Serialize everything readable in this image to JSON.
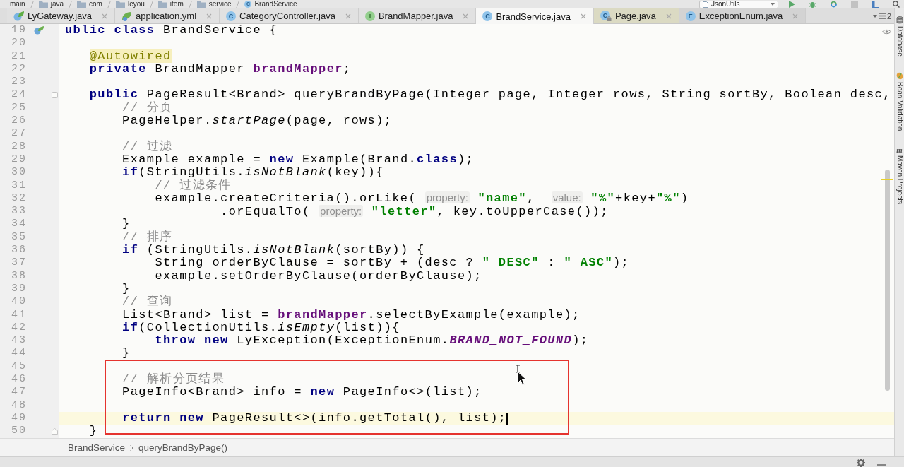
{
  "navigation_bar": {
    "breadcrumb": [
      {
        "label": "main",
        "kind": "plain"
      },
      {
        "label": "java",
        "kind": "folder"
      },
      {
        "label": "com",
        "kind": "folder"
      },
      {
        "label": "leyou",
        "kind": "folder"
      },
      {
        "label": "item",
        "kind": "folder"
      },
      {
        "label": "service",
        "kind": "folder"
      },
      {
        "label": "BrandService",
        "kind": "class",
        "badge": "C"
      }
    ],
    "run_configuration": "JsonUtils"
  },
  "tabs": [
    {
      "label": "LyGateway.java",
      "kind": "spring",
      "selected": false,
      "color": "#e1e1e1"
    },
    {
      "label": "application.yml",
      "kind": "yaml",
      "selected": false,
      "color": "#e1e1e1"
    },
    {
      "label": "CategoryController.java",
      "kind": "class",
      "badge": "C",
      "selected": false,
      "color": "#e1e1e1"
    },
    {
      "label": "BrandMapper.java",
      "kind": "interface",
      "badge": "I",
      "selected": false,
      "color": "#e1e1e1"
    },
    {
      "label": "BrandService.java",
      "kind": "class",
      "badge": "C",
      "selected": true,
      "color": "#f7f7f6"
    },
    {
      "label": "Page.java",
      "kind": "locked-class",
      "badge": "C",
      "selected": false,
      "color": "#dbdac3"
    },
    {
      "label": "ExceptionEnum.java",
      "kind": "enum",
      "badge": "E",
      "selected": false,
      "color": "#d3d3d3"
    }
  ],
  "hidden_tabs": {
    "count": "2"
  },
  "editor": {
    "lines": [
      {
        "number": "19",
        "current": false,
        "marker": {
          "kind": "bean"
        },
        "tokens": [
          {
            "kind": "keyword",
            "text": "ublic"
          },
          {
            "kind": "keyword",
            "text": " class"
          },
          {
            "kind": "plain",
            "text": " BrandService {"
          }
        ]
      },
      {
        "number": "20",
        "current": false
      },
      {
        "number": "21",
        "current": false,
        "tokens": [
          {
            "kind": "annotation",
            "text": "   @Autowired"
          }
        ]
      },
      {
        "number": "22",
        "current": false,
        "tokens": [
          {
            "kind": "keyword",
            "text": "   private"
          },
          {
            "kind": "plain",
            "text": " BrandMapper "
          },
          {
            "kind": "field",
            "text": "brandMapper"
          },
          {
            "kind": "plain",
            "text": ";"
          }
        ]
      },
      {
        "number": "23",
        "current": false
      },
      {
        "number": "24",
        "current": false,
        "marker": {
          "kind": "fold-start"
        },
        "tokens": [
          {
            "kind": "keyword",
            "text": "   public"
          },
          {
            "kind": "plain",
            "text": " PageResult<Brand> queryBrandByPage(Integer page, Integer rows, String sortBy, Boolean desc,"
          }
        ]
      },
      {
        "number": "25",
        "current": false,
        "tokens": [
          {
            "kind": "comment",
            "text": "       // 分页"
          }
        ]
      },
      {
        "number": "26",
        "current": false,
        "tokens": [
          {
            "kind": "plain",
            "text": "       PageHelper."
          },
          {
            "kind": "static",
            "text": "startPage"
          },
          {
            "kind": "plain",
            "text": "(page, rows);"
          }
        ]
      },
      {
        "number": "27",
        "current": false
      },
      {
        "number": "28",
        "current": false,
        "tokens": [
          {
            "kind": "comment",
            "text": "       // 过滤"
          }
        ]
      },
      {
        "number": "29",
        "current": false,
        "tokens": [
          {
            "kind": "plain",
            "text": "       Example example = "
          },
          {
            "kind": "keyword",
            "text": "new"
          },
          {
            "kind": "plain",
            "text": " Example(Brand."
          },
          {
            "kind": "keyword",
            "text": "class"
          },
          {
            "kind": "plain",
            "text": ");"
          }
        ]
      },
      {
        "number": "30",
        "current": false,
        "tokens": [
          {
            "kind": "keyword",
            "text": "       if"
          },
          {
            "kind": "plain",
            "text": "(StringUtils."
          },
          {
            "kind": "static",
            "text": "isNotBlank"
          },
          {
            "kind": "plain",
            "text": "(key)){"
          }
        ]
      },
      {
        "number": "31",
        "current": false,
        "tokens": [
          {
            "kind": "comment",
            "text": "           // 过滤条件"
          }
        ]
      },
      {
        "number": "32",
        "current": false,
        "tokens": [
          {
            "kind": "plain",
            "text": "           example.createCriteria().orLike("
          },
          {
            "kind": "hint",
            "text": " property:"
          },
          {
            "kind": "string",
            "text": " \"name\""
          },
          {
            "kind": "plain",
            "text": ","
          },
          {
            "kind": "hint",
            "text": "  value:"
          },
          {
            "kind": "string",
            "text": " \"%\""
          },
          {
            "kind": "plain",
            "text": "+key+"
          },
          {
            "kind": "string",
            "text": "\"%\""
          },
          {
            "kind": "plain",
            "text": ")"
          }
        ]
      },
      {
        "number": "33",
        "current": false,
        "tokens": [
          {
            "kind": "plain",
            "text": "                   .orEqualTo("
          },
          {
            "kind": "hint",
            "text": " property:"
          },
          {
            "kind": "string",
            "text": " \"letter\""
          },
          {
            "kind": "plain",
            "text": ", key.toUpperCase());"
          }
        ]
      },
      {
        "number": "34",
        "current": false,
        "tokens": [
          {
            "kind": "plain",
            "text": "       }"
          }
        ]
      },
      {
        "number": "35",
        "current": false,
        "tokens": [
          {
            "kind": "comment",
            "text": "       // 排序"
          }
        ]
      },
      {
        "number": "36",
        "current": false,
        "tokens": [
          {
            "kind": "keyword",
            "text": "       if"
          },
          {
            "kind": "plain",
            "text": " (StringUtils."
          },
          {
            "kind": "static",
            "text": "isNotBlank"
          },
          {
            "kind": "plain",
            "text": "(sortBy)) {"
          }
        ]
      },
      {
        "number": "37",
        "current": false,
        "tokens": [
          {
            "kind": "plain",
            "text": "           String orderByClause = sortBy + (desc ? "
          },
          {
            "kind": "string",
            "text": "\" DESC\""
          },
          {
            "kind": "plain",
            "text": " : "
          },
          {
            "kind": "string",
            "text": "\" ASC\""
          },
          {
            "kind": "plain",
            "text": ");"
          }
        ]
      },
      {
        "number": "38",
        "current": false,
        "tokens": [
          {
            "kind": "plain",
            "text": "           example.setOrderByClause(orderByClause);"
          }
        ]
      },
      {
        "number": "39",
        "current": false,
        "tokens": [
          {
            "kind": "plain",
            "text": "       }"
          }
        ]
      },
      {
        "number": "40",
        "current": false,
        "tokens": [
          {
            "kind": "comment",
            "text": "       // 查询"
          }
        ]
      },
      {
        "number": "41",
        "current": false,
        "tokens": [
          {
            "kind": "plain",
            "text": "       List<Brand> list = "
          },
          {
            "kind": "field",
            "text": "brandMapper"
          },
          {
            "kind": "plain",
            "text": ".selectByExample(example);"
          }
        ]
      },
      {
        "number": "42",
        "current": false,
        "tokens": [
          {
            "kind": "keyword",
            "text": "       if"
          },
          {
            "kind": "plain",
            "text": "(CollectionUtils."
          },
          {
            "kind": "static",
            "text": "isEmpty"
          },
          {
            "kind": "plain",
            "text": "(list)){"
          }
        ]
      },
      {
        "number": "43",
        "current": false,
        "tokens": [
          {
            "kind": "keyword",
            "text": "           throw"
          },
          {
            "kind": "keyword",
            "text": " new"
          },
          {
            "kind": "plain",
            "text": " LyException(ExceptionEnum."
          },
          {
            "kind": "constant",
            "text": "BRAND_NOT_FOUND"
          },
          {
            "kind": "plain",
            "text": ");"
          }
        ]
      },
      {
        "number": "44",
        "current": false,
        "tokens": [
          {
            "kind": "plain",
            "text": "       }"
          }
        ]
      },
      {
        "number": "45",
        "current": false
      },
      {
        "number": "46",
        "current": false,
        "tokens": [
          {
            "kind": "comment",
            "text": "       // 解析分页结果"
          }
        ]
      },
      {
        "number": "47",
        "current": false,
        "tokens": [
          {
            "kind": "plain",
            "text": "       PageInfo<Brand> info = "
          },
          {
            "kind": "keyword",
            "text": "new"
          },
          {
            "kind": "plain",
            "text": " PageInfo<>(list);"
          }
        ]
      },
      {
        "number": "48",
        "current": false
      },
      {
        "number": "49",
        "current": true,
        "tokens": [
          {
            "kind": "keyword",
            "text": "       return"
          },
          {
            "kind": "keyword",
            "text": " new"
          },
          {
            "kind": "plain",
            "text": " PageResult<>(info.getTotal(), list);"
          }
        ]
      },
      {
        "number": "50",
        "current": false,
        "marker": {
          "kind": "fold-end"
        },
        "tokens": [
          {
            "kind": "plain",
            "text": "   }"
          }
        ]
      }
    ]
  },
  "tool_windows": [
    {
      "label": "Database",
      "kind": "database"
    },
    {
      "label": "Bean Validation",
      "kind": "bean"
    },
    {
      "label": "Maven Projects",
      "kind": "maven",
      "badge": "m"
    }
  ],
  "code_breadcrumb": [
    {
      "label": "BrandService"
    },
    {
      "label": "queryBrandByPage()"
    }
  ]
}
